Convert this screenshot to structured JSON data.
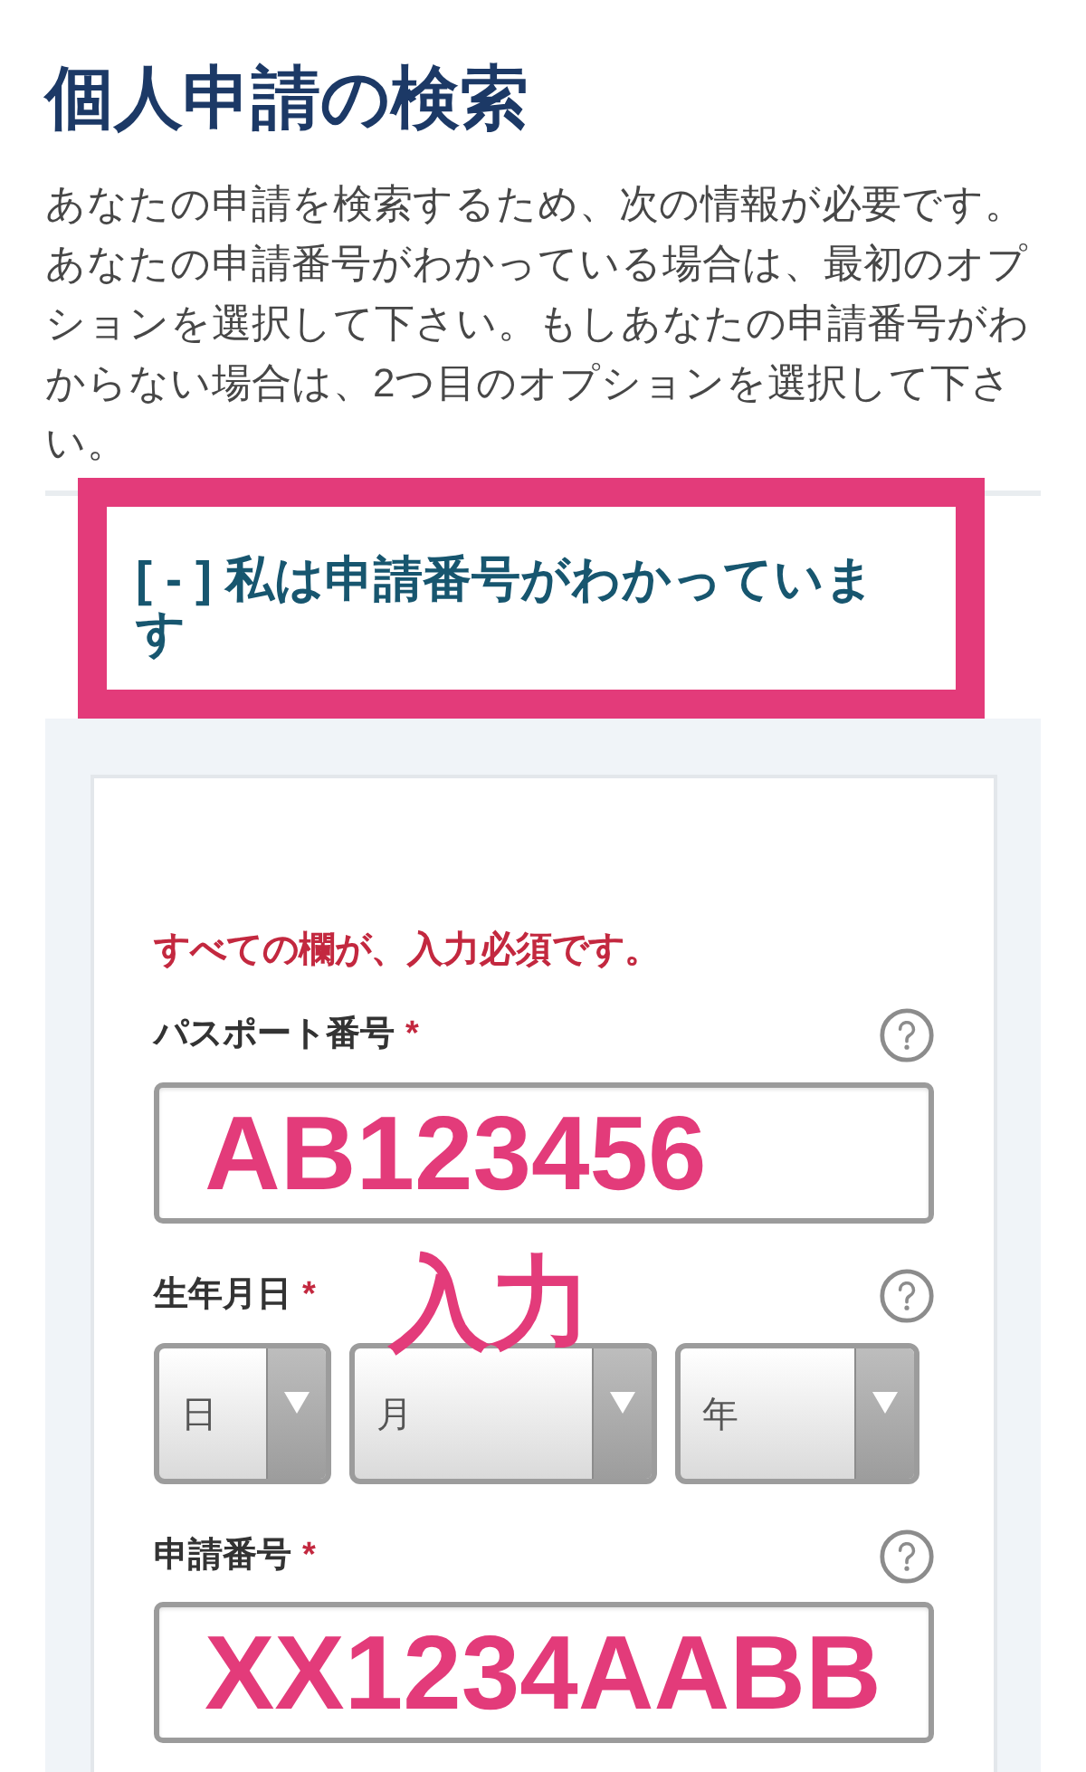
{
  "page": {
    "title": "個人申請の検索",
    "intro": "あなたの申請を検索するため、次の情報が必要です。あなたの申請番号がわかっている場合は、最初のオプションを選択して下さい。もしあなたの申請番号がわからない場合は、2つ目のオプションを選択して下さい。"
  },
  "accordion": {
    "label": "[ - ] 私は申請番号がわかっています",
    "expanded": true,
    "highlighted": true
  },
  "form": {
    "notice": "すべての欄が、入力必須です。",
    "fields": [
      {
        "kind": "text",
        "label": "パスポート番号",
        "required_mark": "*",
        "help": true,
        "value": "AB123456"
      },
      {
        "kind": "date",
        "label": "生年月日",
        "required_mark": "*",
        "help": true,
        "annotation": "入力",
        "selects": [
          {
            "placeholder": "日"
          },
          {
            "placeholder": "月"
          },
          {
            "placeholder": "年"
          }
        ]
      },
      {
        "kind": "text",
        "label": "申請番号",
        "required_mark": "*",
        "help": true,
        "value": "XX1234AABB"
      }
    ]
  }
}
